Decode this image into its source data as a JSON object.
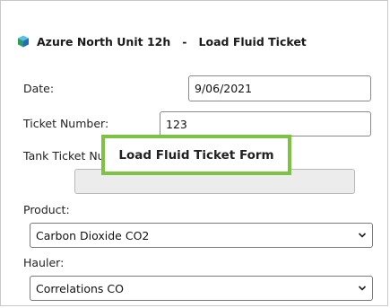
{
  "header": {
    "title": "Azure North Unit 12h   -   Load Fluid Ticket",
    "icon": "cube-icon"
  },
  "form": {
    "date": {
      "label": "Date:",
      "value": "9/06/2021"
    },
    "ticket_number": {
      "label": "Ticket Number:",
      "value": "123"
    },
    "tank_ticket_number": {
      "label": "Tank Ticket Nu",
      "value": ""
    },
    "product": {
      "label": "Product:",
      "value": "Carbon Dioxide CO2"
    },
    "hauler": {
      "label": "Hauler:",
      "value": "Correlations CO"
    }
  },
  "callout": {
    "text": "Load Fluid Ticket Form",
    "border_color": "#7dc242"
  }
}
